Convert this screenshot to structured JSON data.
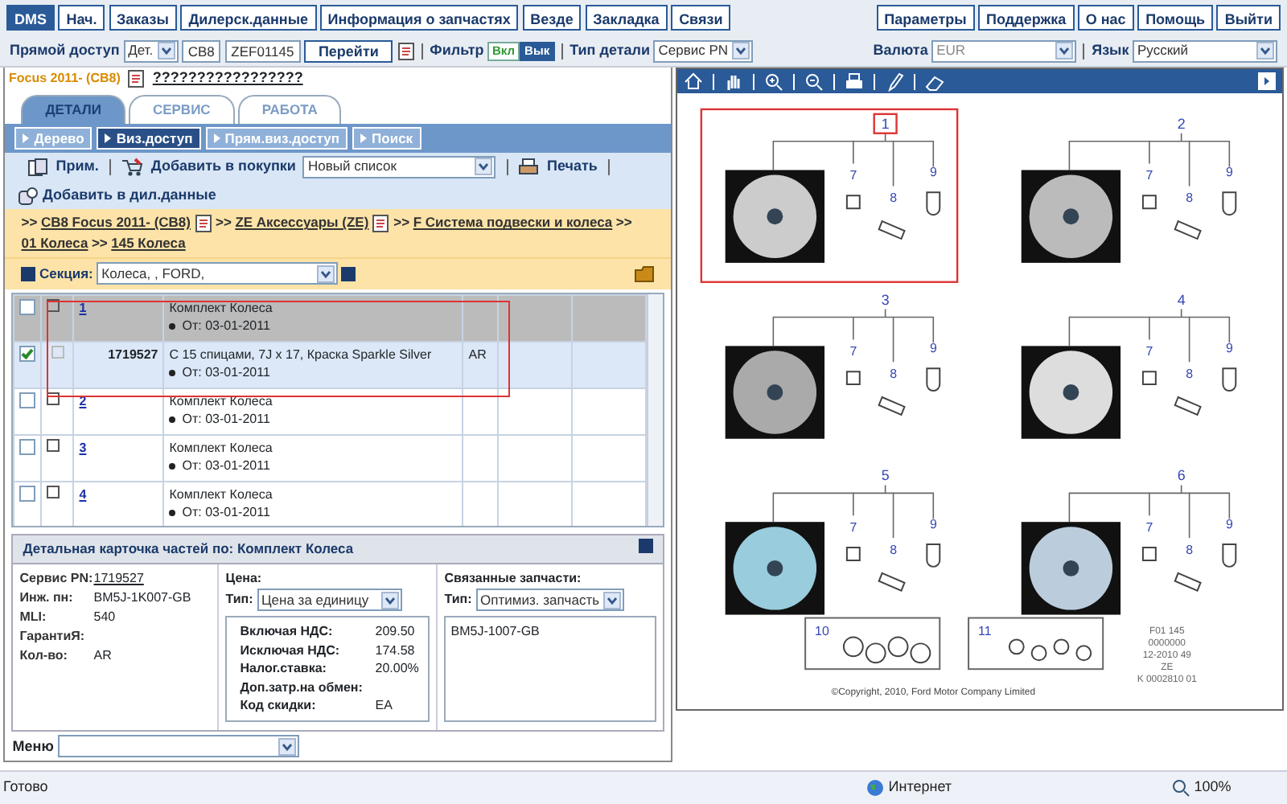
{
  "top_nav": {
    "left": [
      {
        "label": "DMS",
        "selected": true
      },
      {
        "label": "Нач.",
        "selected": false
      },
      {
        "label": "Заказы",
        "selected": false
      },
      {
        "label": "Дилерск.данные",
        "selected": false
      },
      {
        "label": "Информация о запчастях",
        "selected": false
      },
      {
        "label": "Везде",
        "selected": false
      },
      {
        "label": "Закладка",
        "selected": false
      },
      {
        "label": "Связи",
        "selected": false
      }
    ],
    "right": [
      {
        "label": "Параметры"
      },
      {
        "label": "Поддержка"
      },
      {
        "label": "О нас"
      },
      {
        "label": "Помощь"
      },
      {
        "label": "Выйти"
      }
    ]
  },
  "quick_bar": {
    "direct_label": "Прямой доступ",
    "direct_type": "Дет.",
    "catalog": "CB8",
    "code": "ZEF01145",
    "go": "Перейти",
    "filter_label": "Фильтр",
    "filter_options": [
      {
        "label": "Вкл",
        "selected": false
      },
      {
        "label": "Вык",
        "selected": true
      }
    ],
    "part_type_label": "Тип детали",
    "part_type": "Сервис PN",
    "currency_label": "Валюта",
    "currency": {
      "value": "EUR",
      "disabled": true
    },
    "language_label": "Язык",
    "language": "Русский"
  },
  "vehicle": {
    "model": "Focus 2011- (CB8)",
    "link": "?????????????????"
  },
  "tabs": [
    {
      "label": "ДЕТАЛИ",
      "selected": true
    },
    {
      "label": "СЕРВИС",
      "selected": false
    },
    {
      "label": "РАБОТА",
      "selected": false
    }
  ],
  "subnav": [
    {
      "label": "Дерево",
      "selected": false
    },
    {
      "label": "Виз.доступ",
      "selected": true
    },
    {
      "label": "Прям.виз.доступ",
      "selected": false
    },
    {
      "label": "Поиск",
      "selected": false
    }
  ],
  "toolbar": {
    "note": "Прим.",
    "add_to_cart": "Добавить в покупки",
    "list": "Новый список",
    "print": "Печать",
    "add_dealer": "Добавить в дил.данные"
  },
  "breadcrumb": [
    {
      "separator": ">>",
      "label": "CB8 Focus 2011- (CB8)",
      "has_icon": true
    },
    {
      "separator": ">>",
      "label": "ZE Аксессуары (ZE)",
      "has_icon": true
    },
    {
      "separator": ">>",
      "label": "F Система подвески и колеса",
      "has_icon": false
    },
    {
      "separator": ">>",
      "label": "01 Колеса",
      "has_icon": false
    },
    {
      "separator": ">>",
      "label": "145 Колеса",
      "has_icon": false
    }
  ],
  "section": {
    "label": "Секция:",
    "value": "Колеса, , FORD,"
  },
  "table": {
    "rows": [
      {
        "kind": "group",
        "checked": false,
        "selected": false,
        "marked": true,
        "number": "1",
        "description": "Комплект Колеса",
        "date": "От: 03-01-2011"
      },
      {
        "kind": "part",
        "checked": true,
        "selected": true,
        "marked": true,
        "number": "1719527",
        "description": "С 15 спицами, 7J x 17, Краска Sparkle Silver",
        "date": "От: 03-01-2011",
        "code": "AR"
      },
      {
        "kind": "group",
        "checked": false,
        "selected": false,
        "marked": false,
        "number": "2",
        "description": "Комплект Колеса",
        "date": "От: 03-01-2011"
      },
      {
        "kind": "group",
        "checked": false,
        "selected": false,
        "marked": false,
        "number": "3",
        "description": "Комплект Колеса",
        "date": "От: 03-01-2011"
      },
      {
        "kind": "group",
        "checked": false,
        "selected": false,
        "marked": false,
        "number": "4",
        "description": "Комплект Колеса",
        "date": "От: 03-01-2011"
      }
    ]
  },
  "detail_card": {
    "title": "Детальная карточка частей по: Комплект Колеса",
    "fields": [
      {
        "label": "Сервис PN:",
        "value": "1719527",
        "kind": "link"
      },
      {
        "label": "Инж. пн:",
        "value": "BM5J-1K007-GB",
        "kind": "text"
      },
      {
        "label": "MLI:",
        "value": "540",
        "kind": "text"
      },
      {
        "label": "ГарантиЯ:",
        "kind": "text"
      },
      {
        "label": "Кол-во:",
        "value": "AR",
        "kind": "text"
      }
    ],
    "price": {
      "title": "Цена:",
      "type_label": "Тип:",
      "type": "Цена за единицу",
      "rows": [
        {
          "label": "Включая НДС:",
          "value": "209.50"
        },
        {
          "label": "Исключая НДС:",
          "value": "174.58"
        },
        {
          "label": "Налог.ставка:",
          "value": "20.00%"
        },
        {
          "label": "Доп.затр.на обмен:"
        },
        {
          "label": "Код скидки:",
          "value": "EA"
        }
      ]
    },
    "related": {
      "title": "Связанные запчасти:",
      "type_label": "Тип:",
      "type": "Оптимиз. запчасть",
      "items": [
        "BM5J-1007-GB"
      ]
    },
    "menu_label": "Меню"
  },
  "diagram": {
    "groups": [
      {
        "number": "1",
        "selected": true,
        "callouts": [
          "7",
          "8",
          "9"
        ]
      },
      {
        "number": "2",
        "selected": false,
        "callouts": [
          "7",
          "8",
          "9"
        ]
      },
      {
        "number": "3",
        "selected": false,
        "callouts": [
          "7",
          "8",
          "9"
        ]
      },
      {
        "number": "4",
        "selected": false,
        "callouts": [
          "7",
          "8",
          "9"
        ]
      },
      {
        "number": "5",
        "selected": false,
        "callouts": [
          "7",
          "8",
          "9"
        ]
      },
      {
        "number": "6",
        "selected": false,
        "callouts": [
          "7",
          "8",
          "9"
        ]
      }
    ],
    "kits": [
      "10",
      "11"
    ],
    "stamp": [
      "F01 145",
      "0000000",
      "12-2010 49",
      "ZE",
      "K 0002810 01"
    ],
    "copyright": "©Copyright, 2010, Ford Motor Company Limited"
  },
  "status_bar": {
    "text": "Готово",
    "zone": "Интернет",
    "zoom": "100%"
  }
}
